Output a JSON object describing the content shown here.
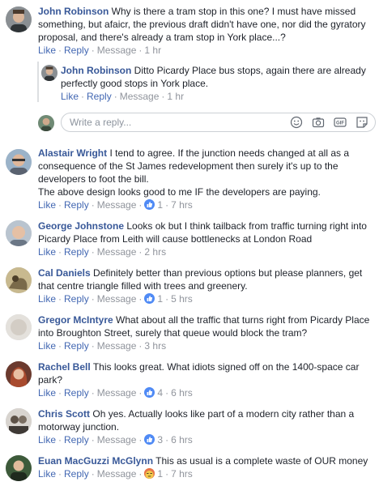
{
  "comments": [
    {
      "author": "John Robinson",
      "text": "Why is there a tram stop in this one? I must have missed something, but afaicr, the previous draft didn't have one, nor did the gyratory proposal, and there's already a tram stop in York place...?",
      "like": "Like",
      "reply": "Reply",
      "message": "Message",
      "time": "1 hr",
      "replies": [
        {
          "author": "John Robinson",
          "text": "Ditto Picardy Place bus stops, again there are already perfectly good stops in York place.",
          "like": "Like",
          "reply": "Reply",
          "message": "Message",
          "time": "1 hr"
        }
      ]
    },
    {
      "author": "Alastair Wright",
      "text": "I tend to agree. If the junction needs changed at all as a consequence of the St James redevelopment then surely it's up to the developers to foot the bill.",
      "text2": "The above design looks good to me IF the developers are paying.",
      "like": "Like",
      "reply": "Reply",
      "message": "Message",
      "reactions": "1",
      "reaction_icon": "like-icon",
      "time": "7 hrs"
    },
    {
      "author": "George Johnstone",
      "text": "Looks ok but I think tailback from traffic turning right into Picardy Place from Leith will cause bottlenecks at London Road",
      "like": "Like",
      "reply": "Reply",
      "message": "Message",
      "time": "2 hrs"
    },
    {
      "author": "Cal Daniels",
      "text": "Definitely better than previous options but please planners, get that centre triangle filled with trees and greenery.",
      "like": "Like",
      "reply": "Reply",
      "message": "Message",
      "reactions": "1",
      "reaction_icon": "like-icon",
      "time": "5 hrs"
    },
    {
      "author": "Gregor McIntyre",
      "text": "What about all the traffic that turns right from Picardy Place into Broughton Street, surely that queue would block the tram?",
      "like": "Like",
      "reply": "Reply",
      "message": "Message",
      "time": "3 hrs"
    },
    {
      "author": "Rachel Bell",
      "text": "This looks great. What idiots signed off on the 1400-space car park?",
      "like": "Like",
      "reply": "Reply",
      "message": "Message",
      "reactions": "4",
      "reaction_icon": "like-icon",
      "time": "6 hrs"
    },
    {
      "author": "Chris Scott",
      "text": "Oh yes. Actually looks like part of a modern city rather than a motorway junction.",
      "like": "Like",
      "reply": "Reply",
      "message": "Message",
      "reactions": "3",
      "reaction_icon": "like-icon",
      "time": "6 hrs"
    },
    {
      "author": "Euan MacGuzzi McGlynn",
      "text": "This as usual is a complete waste of OUR money",
      "like": "Like",
      "reply": "Reply",
      "message": "Message",
      "reactions": "1",
      "reaction_icon": "angry-icon",
      "time": "7 hrs"
    }
  ],
  "reply_box": {
    "placeholder": "Write a reply..."
  },
  "colors": {
    "author": "#385898",
    "link": "#4267b2",
    "meta": "#90949c",
    "like": "#4f8af5"
  }
}
